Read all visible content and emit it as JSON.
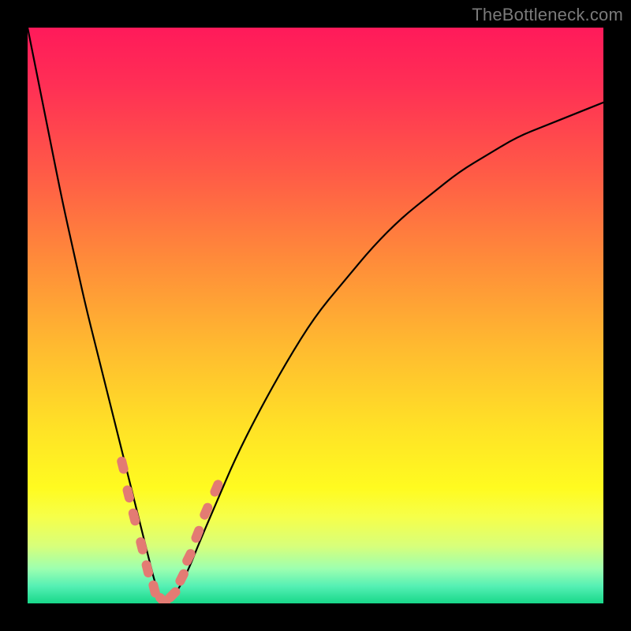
{
  "watermark": "TheBottleneck.com",
  "chart_data": {
    "type": "line",
    "title": "",
    "xlabel": "",
    "ylabel": "",
    "xlim": [
      0,
      100
    ],
    "ylim": [
      0,
      100
    ],
    "grid": false,
    "series": [
      {
        "name": "bottleneck-curve",
        "x": [
          0,
          2,
          4,
          6,
          8,
          10,
          12,
          14,
          16,
          18,
          20,
          21,
          22,
          23,
          24,
          26,
          28,
          30,
          33,
          36,
          40,
          45,
          50,
          55,
          60,
          65,
          70,
          75,
          80,
          85,
          90,
          95,
          100
        ],
        "y": [
          100,
          90,
          80,
          70,
          61,
          52,
          44,
          36,
          28,
          20,
          12,
          8,
          4,
          1,
          0,
          2,
          6,
          11,
          18,
          25,
          33,
          42,
          50,
          56,
          62,
          67,
          71,
          75,
          78,
          81,
          83,
          85,
          87
        ]
      }
    ],
    "markers": {
      "name": "highlight-dots",
      "color": "#e37b73",
      "points": [
        {
          "x": 16.5,
          "y": 24
        },
        {
          "x": 17.5,
          "y": 19
        },
        {
          "x": 18.5,
          "y": 15
        },
        {
          "x": 19.8,
          "y": 10
        },
        {
          "x": 20.8,
          "y": 6
        },
        {
          "x": 22.0,
          "y": 2.5
        },
        {
          "x": 23.5,
          "y": 0.5
        },
        {
          "x": 25.2,
          "y": 1.5
        },
        {
          "x": 26.8,
          "y": 4.5
        },
        {
          "x": 28.0,
          "y": 8
        },
        {
          "x": 29.5,
          "y": 12
        },
        {
          "x": 31.0,
          "y": 16
        },
        {
          "x": 32.8,
          "y": 20
        }
      ]
    },
    "gradient_stops": [
      {
        "pct": 0,
        "color": "#ff1a5a"
      },
      {
        "pct": 25,
        "color": "#ff5a47"
      },
      {
        "pct": 55,
        "color": "#ffb930"
      },
      {
        "pct": 80,
        "color": "#fffb20"
      },
      {
        "pct": 94,
        "color": "#9cffb0"
      },
      {
        "pct": 100,
        "color": "#18d88a"
      }
    ]
  }
}
